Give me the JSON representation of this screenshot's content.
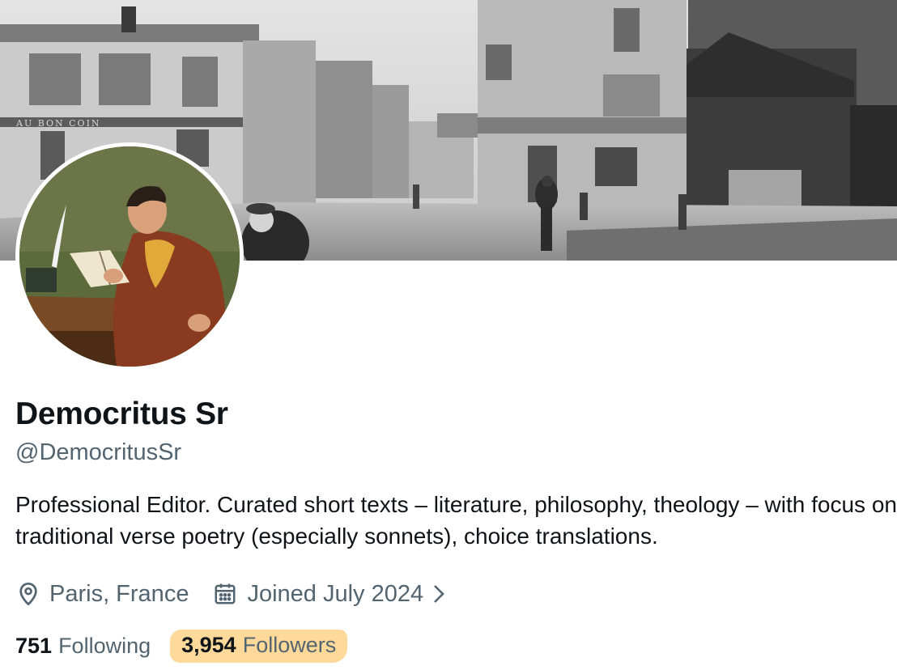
{
  "profile": {
    "display_name": "Democritus Sr",
    "handle": "@DemocritusSr",
    "bio": "Professional Editor. Curated short texts – literature, philosophy, theology – with focus on traditional verse poetry (especially sonnets), choice translations.",
    "location": "Paris, France",
    "joined": "Joined July 2024",
    "location_icon": "map-pin-icon",
    "joined_icon": "calendar-icon",
    "joined_chevron_icon": "chevron-right-icon"
  },
  "banner": {
    "shop_sign": "AU BON COIN"
  },
  "stats": {
    "following_count": "751",
    "following_label": "Following",
    "followers_count": "3,954",
    "followers_label": "Followers",
    "highlight_color": "#ffd99a"
  }
}
